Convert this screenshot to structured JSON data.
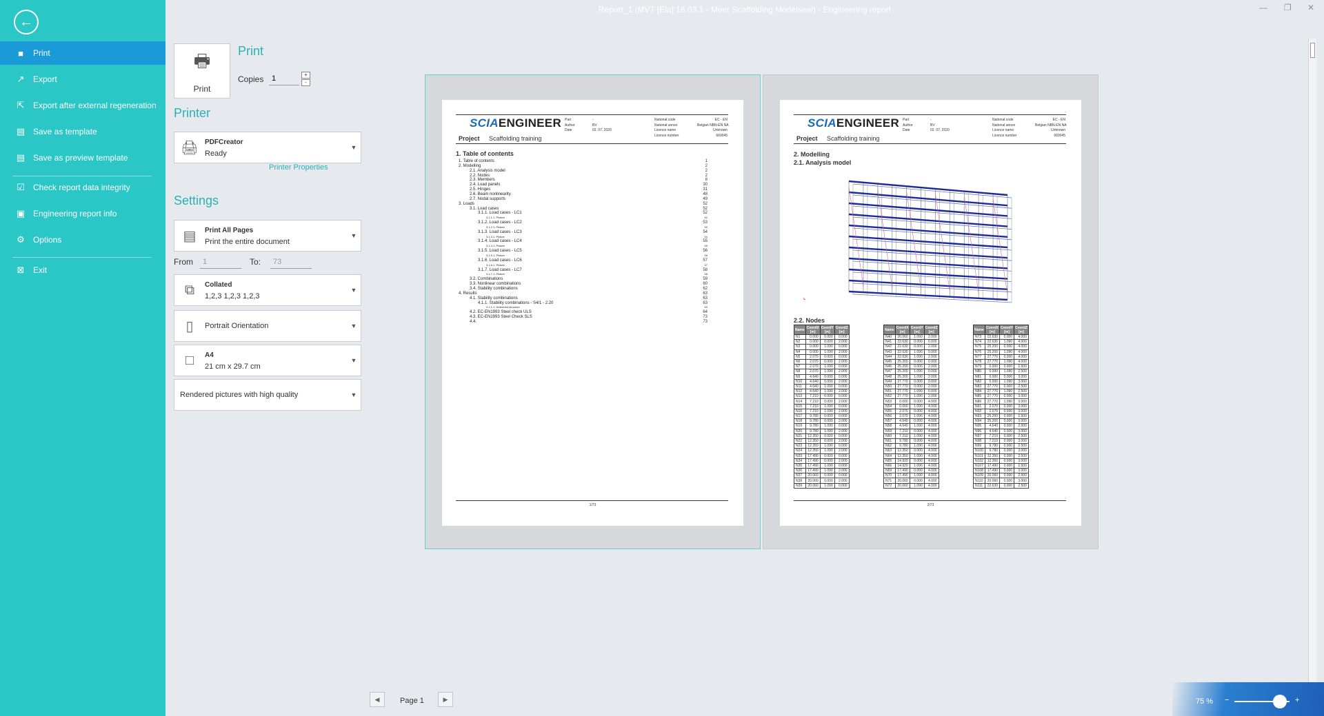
{
  "window": {
    "title": "Report_1 (MVT [Ela] 16.03.1 - Meer Scaffolding Modelseal) - Engineering report"
  },
  "nav": {
    "items": [
      {
        "label": "Print",
        "icon": "square-icon",
        "glyph": "■"
      },
      {
        "label": "Export",
        "icon": "export-icon",
        "glyph": "↗"
      },
      {
        "label": "Export after external regeneration",
        "icon": "export-regenerate-icon",
        "glyph": "⇱"
      },
      {
        "label": "Save as template",
        "icon": "save-template-icon",
        "glyph": "▤"
      },
      {
        "label": "Save as preview template",
        "icon": "save-preview-template-icon",
        "glyph": "▤"
      },
      {
        "label": "Check report data integrity",
        "icon": "check-integrity-icon",
        "glyph": "☑"
      },
      {
        "label": "Engineering report info",
        "icon": "report-info-icon",
        "glyph": "▣"
      },
      {
        "label": "Options",
        "icon": "gear-icon",
        "glyph": "⚙"
      },
      {
        "label": "Exit",
        "icon": "exit-icon",
        "glyph": "⊠"
      }
    ]
  },
  "print_panel": {
    "print_button": "Print",
    "print_title": "Print",
    "copies_label": "Copies",
    "copies_value": "1",
    "printer_title": "Printer",
    "printer_name": "PDFCreator",
    "printer_status": "Ready",
    "printer_properties": "Printer Properties",
    "settings_title": "Settings",
    "pages_title": "Print All Pages",
    "pages_sub": "Print the entire document",
    "from_label": "From",
    "from_value": "1",
    "to_label": "To:",
    "to_value": "73",
    "collate_title": "Collated",
    "collate_sub": "1,2,3   1,2,3   1,2,3",
    "orientation": "Portrait Orientation",
    "paper_title": "A4",
    "paper_sub": "21 cm x 29.7 cm",
    "quality": "Rendered pictures with high quality"
  },
  "report": {
    "logo_a": "SCIA",
    "logo_b": "ENGINEER",
    "project_label": "Project",
    "project_value": "Scaffolding training",
    "header_left_labels": "Part\nAuthor\nDate",
    "header_left_values": "-\nBV\n02. 07. 2020",
    "header_right_labels": "National code\nNational annex\nLicence name\nLicence number",
    "header_right_values": "EC - EN\nBelgian NBN-EN NA\nUnknown\n660045",
    "page1": {
      "heading": "1. Table of contents",
      "footer": "1/73",
      "toc": [
        {
          "t": "1. Table of contents",
          "n": "1",
          "lvl": 1
        },
        {
          "t": "2. Modelling",
          "n": "2",
          "lvl": 1
        },
        {
          "t": "2.1. Analysis model",
          "n": "2",
          "lvl": 2
        },
        {
          "t": "2.2. Nodes",
          "n": "2",
          "lvl": 2
        },
        {
          "t": "2.3. Members",
          "n": "8",
          "lvl": 2
        },
        {
          "t": "2.4. Load panels",
          "n": "30",
          "lvl": 2
        },
        {
          "t": "2.5. Hinges",
          "n": "31",
          "lvl": 2
        },
        {
          "t": "2.6. Beam nonlinearity",
          "n": "48",
          "lvl": 2
        },
        {
          "t": "2.7. Nodal supports",
          "n": "49",
          "lvl": 2
        },
        {
          "t": "3. Loads",
          "n": "52",
          "lvl": 1
        },
        {
          "t": "3.1. Load cases",
          "n": "52",
          "lvl": 2
        },
        {
          "t": "3.1.1. Load cases - LC1",
          "n": "52",
          "lvl": 3
        },
        {
          "t": "3.1.1.1. Picture",
          "n": "52",
          "lvl": 4
        },
        {
          "t": "3.1.2. Load cases - LC2",
          "n": "53",
          "lvl": 3
        },
        {
          "t": "3.1.2.1. Picture",
          "n": "53",
          "lvl": 4
        },
        {
          "t": "3.1.3. Load cases - LC3",
          "n": "54",
          "lvl": 3
        },
        {
          "t": "3.1.3.1. Picture",
          "n": "54",
          "lvl": 4
        },
        {
          "t": "3.1.4. Load cases - LC4",
          "n": "55",
          "lvl": 3
        },
        {
          "t": "3.1.4.1. Picture",
          "n": "55",
          "lvl": 4
        },
        {
          "t": "3.1.5. Load cases - LC5",
          "n": "56",
          "lvl": 3
        },
        {
          "t": "3.1.5.1. Picture",
          "n": "56",
          "lvl": 4
        },
        {
          "t": "3.1.6. Load cases - LC6",
          "n": "57",
          "lvl": 3
        },
        {
          "t": "3.1.6.1. Picture",
          "n": "57",
          "lvl": 4
        },
        {
          "t": "3.1.7. Load cases - LC7",
          "n": "58",
          "lvl": 3
        },
        {
          "t": "3.1.7.1. Picture",
          "n": "58",
          "lvl": 4
        },
        {
          "t": "3.2. Combinations",
          "n": "59",
          "lvl": 2
        },
        {
          "t": "3.3. Nonlinear combinations",
          "n": "60",
          "lvl": 2
        },
        {
          "t": "3.4. Stability combinations",
          "n": "62",
          "lvl": 2
        },
        {
          "t": "4. Results",
          "n": "63",
          "lvl": 1
        },
        {
          "t": "4.1. Stability combinations",
          "n": "63",
          "lvl": 2
        },
        {
          "t": "4.1.1. Stability combinations - S4/1 - 2.20",
          "n": "63",
          "lvl": 3
        },
        {
          "t": "4.1.1.1. Deformed structure",
          "n": "63",
          "lvl": 4
        },
        {
          "t": "4.2. EC-EN1993 Steel check ULS",
          "n": "64",
          "lvl": 2
        },
        {
          "t": "4.3. EC-EN1993 Steel Check SLS",
          "n": "73",
          "lvl": 2
        },
        {
          "t": "4.4.",
          "n": "73",
          "lvl": 2
        }
      ]
    },
    "page2": {
      "heading": "2. Modelling",
      "subheading": "2.1. Analysis model",
      "nodes_heading": "2.2. Nodes",
      "footer": "2/73",
      "col_headers": [
        "Name",
        "CoordX\n[m]",
        "CoordY\n[m]",
        "CoordZ\n[m]"
      ],
      "table1": [
        [
          "N1",
          "0.000",
          "0.000",
          "0.000"
        ],
        [
          "N2",
          "0.000",
          "0.000",
          "2.000"
        ],
        [
          "N3",
          "0.000",
          "1.090",
          "0.000"
        ],
        [
          "N4",
          "0.000",
          "1.090",
          "2.000"
        ],
        [
          "N5",
          "2.070",
          "0.000",
          "0.000"
        ],
        [
          "N6",
          "2.070",
          "0.000",
          "2.000"
        ],
        [
          "N7",
          "2.070",
          "1.090",
          "0.000"
        ],
        [
          "N8",
          "2.070",
          "1.090",
          "2.000"
        ],
        [
          "N9",
          "4.640",
          "0.000",
          "0.000"
        ],
        [
          "N10",
          "4.640",
          "0.000",
          "2.000"
        ],
        [
          "N11",
          "4.640",
          "1.090",
          "0.000"
        ],
        [
          "N12",
          "4.640",
          "1.090",
          "2.000"
        ],
        [
          "N13",
          "7.210",
          "0.000",
          "0.000"
        ],
        [
          "N14",
          "7.210",
          "0.000",
          "2.000"
        ],
        [
          "N15",
          "7.210",
          "1.090",
          "0.000"
        ],
        [
          "N16",
          "7.210",
          "1.090",
          "2.000"
        ],
        [
          "N17",
          "9.780",
          "0.000",
          "0.000"
        ],
        [
          "N18",
          "9.780",
          "0.000",
          "2.000"
        ],
        [
          "N19",
          "9.780",
          "1.090",
          "0.000"
        ],
        [
          "N20",
          "9.780",
          "1.090",
          "2.000"
        ],
        [
          "N21",
          "12.350",
          "0.000",
          "0.000"
        ],
        [
          "N22",
          "12.350",
          "0.000",
          "2.000"
        ],
        [
          "N23",
          "12.350",
          "1.090",
          "0.000"
        ],
        [
          "N24",
          "12.350",
          "1.090",
          "2.000"
        ],
        [
          "N33",
          "17.490",
          "0.000",
          "0.000"
        ],
        [
          "N34",
          "17.490",
          "0.000",
          "2.000"
        ],
        [
          "N35",
          "17.490",
          "1.090",
          "0.000"
        ],
        [
          "N36",
          "17.490",
          "1.090",
          "2.000"
        ],
        [
          "N37",
          "20.060",
          "0.000",
          "0.000"
        ],
        [
          "N38",
          "20.060",
          "0.000",
          "2.000"
        ],
        [
          "N39",
          "20.060",
          "1.090",
          "0.000"
        ]
      ],
      "table2": [
        [
          "N40",
          "20.060",
          "1.090",
          "2.000"
        ],
        [
          "N41",
          "22.630",
          "0.000",
          "0.000"
        ],
        [
          "N42",
          "22.630",
          "0.000",
          "2.000"
        ],
        [
          "N43",
          "22.630",
          "1.090",
          "0.000"
        ],
        [
          "N44",
          "22.630",
          "1.090",
          "2.000"
        ],
        [
          "N45",
          "25.200",
          "0.000",
          "0.000"
        ],
        [
          "N46",
          "25.200",
          "0.000",
          "2.000"
        ],
        [
          "N47",
          "25.200",
          "1.090",
          "0.000"
        ],
        [
          "N48",
          "25.200",
          "1.090",
          "2.000"
        ],
        [
          "N49",
          "27.770",
          "0.000",
          "0.000"
        ],
        [
          "N50",
          "27.770",
          "0.000",
          "2.000"
        ],
        [
          "N51",
          "27.770",
          "1.090",
          "0.000"
        ],
        [
          "N52",
          "27.770",
          "1.090",
          "2.000"
        ],
        [
          "N53",
          "0.000",
          "0.000",
          "4.000"
        ],
        [
          "N54",
          "0.000",
          "1.090",
          "4.000"
        ],
        [
          "N55",
          "2.070",
          "0.000",
          "4.000"
        ],
        [
          "N56",
          "2.070",
          "1.090",
          "4.000"
        ],
        [
          "N57",
          "4.640",
          "0.000",
          "4.000"
        ],
        [
          "N58",
          "4.640",
          "1.090",
          "4.000"
        ],
        [
          "N59",
          "7.210",
          "0.000",
          "4.000"
        ],
        [
          "N60",
          "7.210",
          "1.090",
          "4.000"
        ],
        [
          "N61",
          "9.780",
          "0.000",
          "4.000"
        ],
        [
          "N62",
          "9.780",
          "1.090",
          "4.000"
        ],
        [
          "N63",
          "12.350",
          "0.000",
          "4.000"
        ],
        [
          "N64",
          "12.350",
          "1.090",
          "4.000"
        ],
        [
          "N65",
          "14.920",
          "0.000",
          "4.000"
        ],
        [
          "N66",
          "14.920",
          "1.090",
          "4.000"
        ],
        [
          "N69",
          "17.490",
          "0.000",
          "4.000"
        ],
        [
          "N70",
          "17.490",
          "1.090",
          "4.000"
        ],
        [
          "N71",
          "20.060",
          "0.000",
          "4.000"
        ],
        [
          "N72",
          "20.060",
          "1.090",
          "4.000"
        ]
      ],
      "table3": [
        [
          "N73",
          "22.630",
          "0.000",
          "4.000"
        ],
        [
          "N74",
          "22.630",
          "1.090",
          "4.000"
        ],
        [
          "N75",
          "25.200",
          "0.000",
          "4.000"
        ],
        [
          "N76",
          "25.200",
          "1.090",
          "4.000"
        ],
        [
          "N77",
          "27.770",
          "0.000",
          "4.000"
        ],
        [
          "N78",
          "27.770",
          "1.090",
          "4.000"
        ],
        [
          "N79",
          "0.000",
          "0.000",
          "2.500"
        ],
        [
          "N80",
          "0.000",
          "1.090",
          "2.500"
        ],
        [
          "N81",
          "0.000",
          "0.000",
          "3.000"
        ],
        [
          "N82",
          "0.000",
          "1.090",
          "3.000"
        ],
        [
          "N83",
          "27.770",
          "0.000",
          "2.500"
        ],
        [
          "N84",
          "27.770",
          "1.090",
          "2.500"
        ],
        [
          "N85",
          "27.770",
          "0.000",
          "3.000"
        ],
        [
          "N86",
          "27.770",
          "1.090",
          "3.000"
        ],
        [
          "N91",
          "2.070",
          "0.000",
          "3.000"
        ],
        [
          "N92",
          "2.070",
          "0.000",
          "3.000"
        ],
        [
          "N93",
          "25.200",
          "0.000",
          "2.500"
        ],
        [
          "N94",
          "25.200",
          "0.000",
          "3.000"
        ],
        [
          "N95",
          "4.640",
          "0.000",
          "2.500"
        ],
        [
          "N96",
          "4.640",
          "0.000",
          "3.000"
        ],
        [
          "N97",
          "7.210",
          "0.000",
          "2.500"
        ],
        [
          "N98",
          "7.210",
          "0.000",
          "3.000"
        ],
        [
          "N99",
          "9.780",
          "0.000",
          "2.500"
        ],
        [
          "N100",
          "9.780",
          "0.000",
          "3.000"
        ],
        [
          "N101",
          "12.350",
          "0.000",
          "2.500"
        ],
        [
          "N102",
          "12.350",
          "0.000",
          "3.000"
        ],
        [
          "N107",
          "17.490",
          "0.000",
          "2.500"
        ],
        [
          "N108",
          "17.490",
          "0.000",
          "3.000"
        ],
        [
          "N109",
          "20.060",
          "0.000",
          "2.500"
        ],
        [
          "N110",
          "20.060",
          "0.000",
          "3.000"
        ],
        [
          "N111",
          "22.630",
          "0.000",
          "2.500"
        ]
      ]
    }
  },
  "pager": {
    "label": "Page 1"
  },
  "zoom": {
    "label": "75 %",
    "level_percent": 75
  }
}
